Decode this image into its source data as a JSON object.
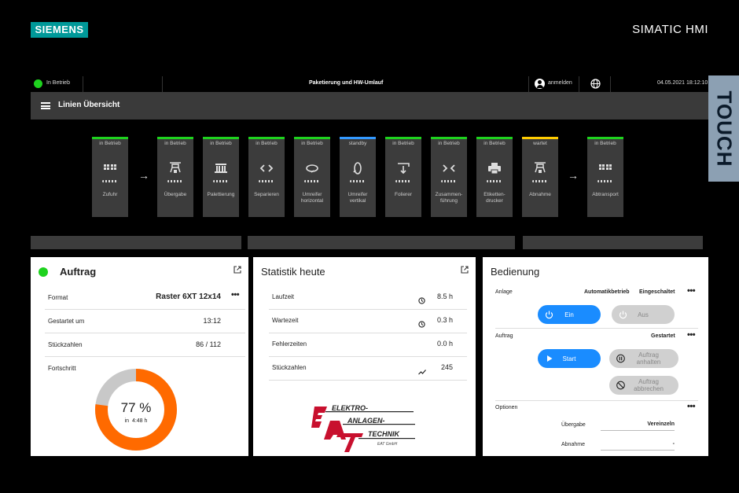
{
  "frame": {
    "brand": "SIEMENS",
    "product": "SIMATIC HMI",
    "touch_label": "TOUCH"
  },
  "statusbar": {
    "state": "In Betrieb",
    "center_title": "Paketierung und HW-Umlauf",
    "login": "anmelden",
    "datetime": "04.05.2021 18:12:10"
  },
  "titlebar": {
    "title": "Linien Übersicht"
  },
  "stations": [
    {
      "status": "in Betrieb",
      "label": "Zufuhr",
      "label2": "",
      "color": "#1ed21e",
      "icon": "grid-icon"
    },
    {
      "status": "in Betrieb",
      "label": "Übergabe",
      "label2": "",
      "color": "#1ed21e",
      "icon": "gripper-icon"
    },
    {
      "status": "in Betrieb",
      "label": "Palettierung",
      "label2": "",
      "color": "#1ed21e",
      "icon": "pallet-icon"
    },
    {
      "status": "in Betrieb",
      "label": "Separieren",
      "label2": "",
      "color": "#1ed21e",
      "icon": "separate-icon"
    },
    {
      "status": "in Betrieb",
      "label": "Umreifer",
      "label2": "horizontal",
      "color": "#1ed21e",
      "icon": "strap-horizontal-icon"
    },
    {
      "status": "standby",
      "label": "Umreifer",
      "label2": "vertikal",
      "color": "#3399ff",
      "icon": "strap-vertical-icon"
    },
    {
      "status": "in Betrieb",
      "label": "Folierer",
      "label2": "",
      "color": "#1ed21e",
      "icon": "wrap-icon"
    },
    {
      "status": "in Betrieb",
      "label": "Zusammen-",
      "label2": "führung",
      "color": "#1ed21e",
      "icon": "merge-icon"
    },
    {
      "status": "in Betrieb",
      "label": "Etiketten-",
      "label2": "drucker",
      "color": "#1ed21e",
      "icon": "printer-icon"
    },
    {
      "status": "wartet",
      "label": "Abnahme",
      "label2": "",
      "color": "#ffcc00",
      "icon": "gripper-icon"
    },
    {
      "status": "in Betrieb",
      "label": "Abtransport",
      "label2": "",
      "color": "#1ed21e",
      "icon": "grid-icon"
    }
  ],
  "auftrag": {
    "title": "Auftrag",
    "status_color": "#1ed21e",
    "format_label": "Format",
    "format_value": "Raster 6XT 12x14",
    "started_label": "Gestartet um",
    "started_value": "13:12",
    "count_label": "Stückzahlen",
    "count_value": "86 / 112",
    "progress_label": "Fortschritt",
    "progress_text": "77 %",
    "progress_value": 0.77,
    "remaining_prefix": "in",
    "remaining": "4:48 h",
    "progress_color": "#ff6a00"
  },
  "statistik": {
    "title": "Statistik heute",
    "rows": [
      {
        "label": "Laufzeit",
        "value": "8.5 h",
        "icon": "clock-icon"
      },
      {
        "label": "Wartezeit",
        "value": "0.3 h",
        "icon": "clock-icon"
      },
      {
        "label": "Fehlerzeiten",
        "value": "0.0 h",
        "icon": ""
      },
      {
        "label": "Stückzahlen",
        "value": "245",
        "icon": "trend-icon"
      }
    ],
    "logo_line1": "ELEKTRO-",
    "logo_line2": "ANLAGEN-",
    "logo_line3": "TECHNIK",
    "logo_sub": "EAT GmbH"
  },
  "bedienung": {
    "title": "Bedienung",
    "anlage_label": "Anlage",
    "anlage_mode": "Automatikbetrieb",
    "anlage_state": "Eingeschaltet",
    "ein": "Ein",
    "aus": "Aus",
    "auftrag_label": "Auftrag",
    "auftrag_state": "Gestartet",
    "start": "Start",
    "pause_l1": "Auftrag",
    "pause_l2": "anhalten",
    "abort_l1": "Auftrag",
    "abort_l2": "abbrechen",
    "optionen_label": "Optionen",
    "uebergabe_label": "Übergabe",
    "uebergabe_value": "Vereinzeln",
    "abnahme_label": "Abnahme",
    "abnahme_value": "-"
  }
}
